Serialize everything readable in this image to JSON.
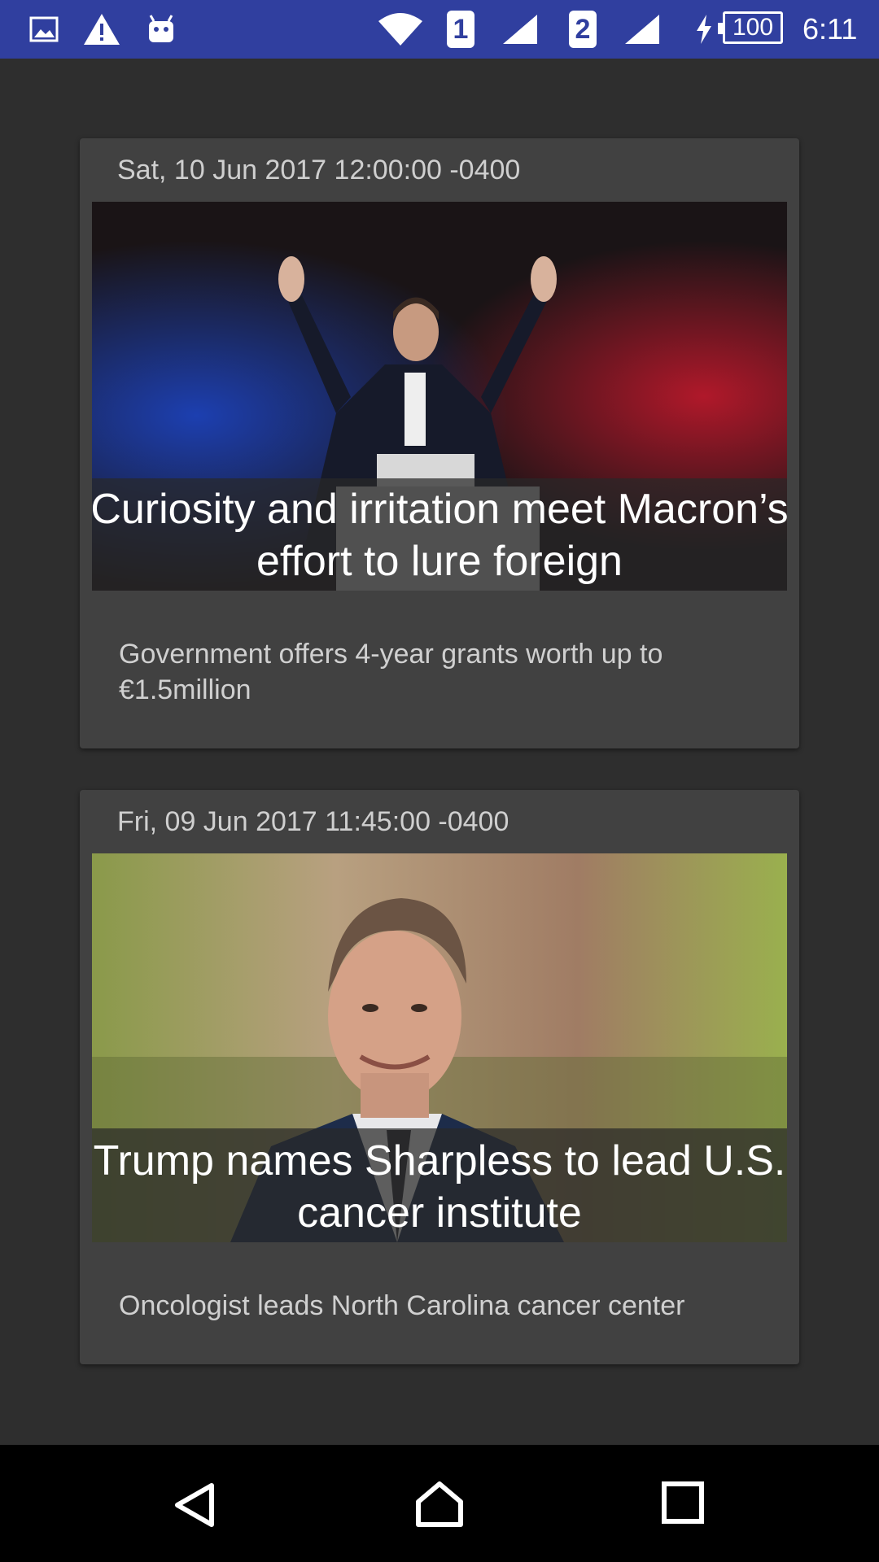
{
  "status_bar": {
    "left_icons": [
      "image-icon",
      "warning-icon",
      "android-icon"
    ],
    "sim1_label": "1",
    "sim2_label": "2",
    "battery_level": "100",
    "time": "6:11"
  },
  "articles": [
    {
      "date": "Sat, 10 Jun 2017 12:00:00 -0400",
      "headline": "Curiosity and irritation meet Macron’s effort to lure foreign",
      "summary": "Government offers 4-year grants worth up to €1.5million"
    },
    {
      "date": "Fri, 09 Jun 2017 11:45:00 -0400",
      "headline": "Trump names Sharpless to lead U.S. cancer institute",
      "summary": "Oncologist leads North Carolina cancer center"
    }
  ],
  "nav_bar": {
    "icons": [
      "back-icon",
      "home-icon",
      "recents-icon"
    ]
  }
}
